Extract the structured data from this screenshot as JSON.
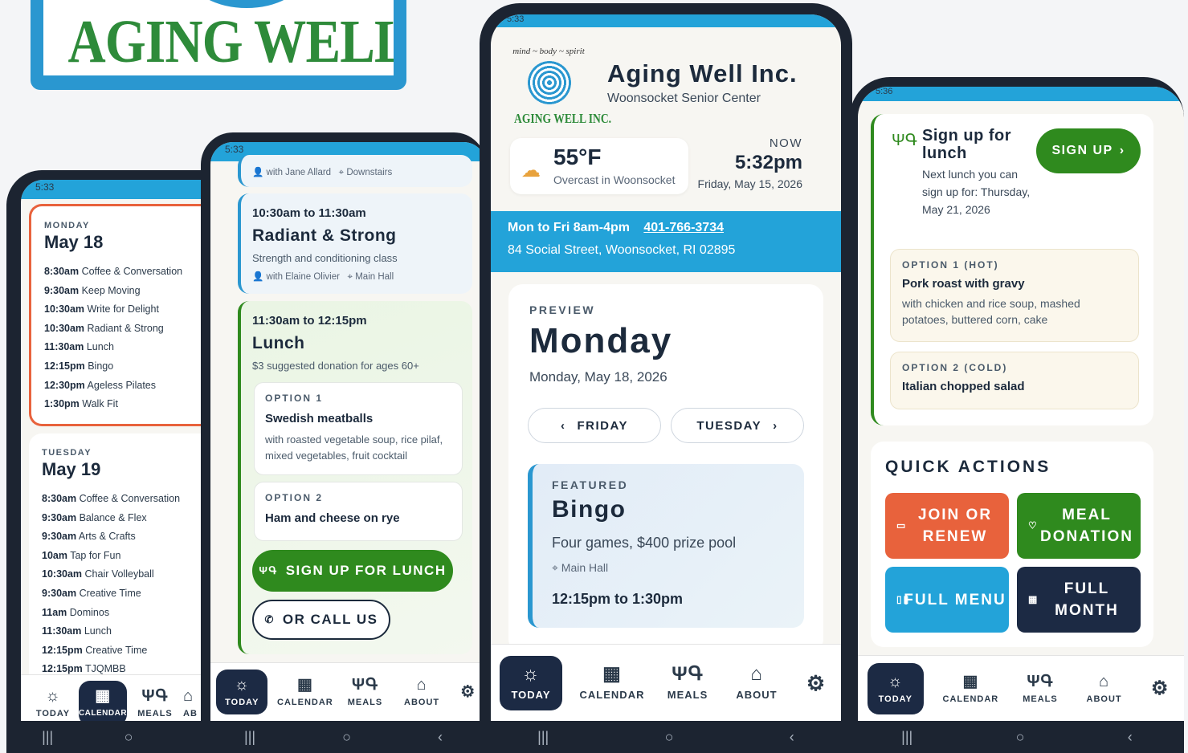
{
  "logo": {
    "text": "AGING WELL INC."
  },
  "phone1": {
    "status_time": "5:33",
    "days": [
      {
        "dow": "MONDAY",
        "date": "May 18",
        "events": [
          {
            "time": "8:30am",
            "title": "Coffee & Conversation"
          },
          {
            "time": "9:30am",
            "title": "Keep Moving"
          },
          {
            "time": "10:30am",
            "title": "Write for Delight"
          },
          {
            "time": "10:30am",
            "title": "Radiant & Strong"
          },
          {
            "time": "11:30am",
            "title": "Lunch"
          },
          {
            "time": "12:15pm",
            "title": "Bingo"
          },
          {
            "time": "12:30pm",
            "title": "Ageless Pilates"
          },
          {
            "time": "1:30pm",
            "title": "Walk Fit"
          }
        ]
      },
      {
        "dow": "TUESDAY",
        "date": "May 19",
        "events": [
          {
            "time": "8:30am",
            "title": "Coffee & Conversation"
          },
          {
            "time": "9:30am",
            "title": "Balance & Flex"
          },
          {
            "time": "9:30am",
            "title": "Arts & Crafts"
          },
          {
            "time": "10am",
            "title": "Tap for Fun"
          },
          {
            "time": "10:30am",
            "title": "Chair Volleyball"
          },
          {
            "time": "9:30am",
            "title": "Creative Time"
          },
          {
            "time": "11am",
            "title": "Dominos"
          },
          {
            "time": "11:30am",
            "title": "Lunch"
          },
          {
            "time": "12:15pm",
            "title": "Creative Time"
          },
          {
            "time": "12:15pm",
            "title": "TJQMBB"
          }
        ]
      }
    ],
    "nav": {
      "today": "TODAY",
      "calendar": "CALENDAR",
      "meals": "MEALS",
      "about": "AB"
    }
  },
  "phone2": {
    "status_time": "5:33",
    "top_meta": {
      "instructor": "with Jane Allard",
      "location": "Downstairs"
    },
    "event": {
      "time": "10:30am to 11:30am",
      "title": "Radiant & Strong",
      "desc": "Strength and conditioning class",
      "instructor": "with Elaine Olivier",
      "location": "Main Hall"
    },
    "lunch": {
      "time": "11:30am to 12:15pm",
      "title": "Lunch",
      "desc": "$3 suggested donation for ages 60+",
      "option1": {
        "label": "OPTION 1",
        "name": "Swedish meatballs",
        "desc": "with roasted vegetable soup, rice pilaf, mixed vegetables, fruit cocktail"
      },
      "option2": {
        "label": "OPTION 2",
        "name": "Ham and cheese on rye"
      },
      "signup": "SIGN UP FOR LUNCH",
      "call": "OR CALL US"
    },
    "nav": {
      "today": "TODAY",
      "calendar": "CALENDAR",
      "meals": "MEALS",
      "about": "ABOUT"
    }
  },
  "phone3": {
    "status_time": "5:33",
    "logo_tagline": "mind ~ body ~ spirit",
    "logo_text": "AGING WELL INC.",
    "title": "Aging Well Inc.",
    "subtitle": "Woonsocket Senior Center",
    "weather": {
      "temp": "55°F",
      "desc": "Overcast in Woonsocket"
    },
    "now": {
      "label": "NOW",
      "time": "5:32pm",
      "date": "Friday, May 15, 2026"
    },
    "info": {
      "hours": "Mon to Fri 8am-4pm",
      "phone": "401-766-3734",
      "address": "84 Social Street, Woonsocket, RI 02895"
    },
    "preview": {
      "label": "PREVIEW",
      "day": "Monday",
      "date": "Monday, May 18, 2026",
      "prev": "FRIDAY",
      "next": "TUESDAY"
    },
    "featured": {
      "label": "FEATURED",
      "title": "Bingo",
      "desc": "Four games, $400 prize pool",
      "location": "Main Hall",
      "time": "12:15pm to 1:30pm"
    },
    "nav": {
      "today": "TODAY",
      "calendar": "CALENDAR",
      "meals": "MEALS",
      "about": "ABOUT"
    }
  },
  "phone4": {
    "status_time": "5:36",
    "signup": {
      "title": "Sign up for lunch",
      "button": "SIGN UP",
      "desc": "Next lunch you can sign up for: Thursday, May 21, 2026"
    },
    "option1": {
      "label": "OPTION 1 (HOT)",
      "name": "Pork roast with gravy",
      "desc": "with chicken and rice soup, mashed potatoes, buttered corn, cake"
    },
    "option2": {
      "label": "OPTION 2 (COLD)",
      "name": "Italian chopped salad"
    },
    "quick": {
      "title": "QUICK ACTIONS",
      "join": "JOIN OR RENEW",
      "donation": "MEAL DONATION",
      "menu": "FULL MENU",
      "month": "FULL MONTH"
    },
    "nav": {
      "today": "TODAY",
      "calendar": "CALENDAR",
      "meals": "MEALS",
      "about": "ABOUT"
    }
  },
  "colors": {
    "blue": "#23a3d9",
    "green": "#2f8a1e",
    "orange": "#e8623c",
    "navy": "#1c2a44"
  }
}
